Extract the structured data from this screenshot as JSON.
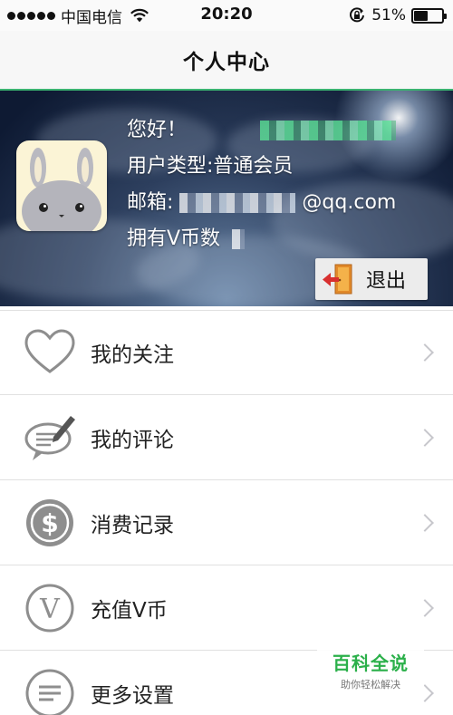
{
  "status_bar": {
    "carrier": "中国电信",
    "time": "20:20",
    "battery_percent": "51%",
    "battery_level": 0.51,
    "icons": [
      "signal-dots-icon",
      "wifi-icon",
      "rotation-lock-icon",
      "battery-icon"
    ]
  },
  "nav": {
    "title": "个人中心"
  },
  "profile": {
    "greeting": "您好！",
    "user_type": "用户类型:普通会员",
    "email_prefix": "邮箱:",
    "email_suffix": "@qq.com",
    "vcoins_prefix": "拥有V币数",
    "logout_label": "退出",
    "avatar_icon": "bunny-avatar-icon"
  },
  "menu": {
    "items": [
      {
        "label": "我的关注",
        "icon": "heart-outline-icon"
      },
      {
        "label": "我的评论",
        "icon": "comment-pencil-icon"
      },
      {
        "label": "消费记录",
        "icon": "dollar-coin-icon"
      },
      {
        "label": "充值V币",
        "icon": "v-coin-icon"
      },
      {
        "label": "更多设置",
        "icon": "settings-list-icon"
      }
    ]
  },
  "watermark": {
    "title": "百科全说",
    "subtitle": "助你轻松解决"
  },
  "colors": {
    "accent_green": "#3bb371",
    "watermark_green": "#2bb04a",
    "icon_gray": "#8e8e8e"
  }
}
